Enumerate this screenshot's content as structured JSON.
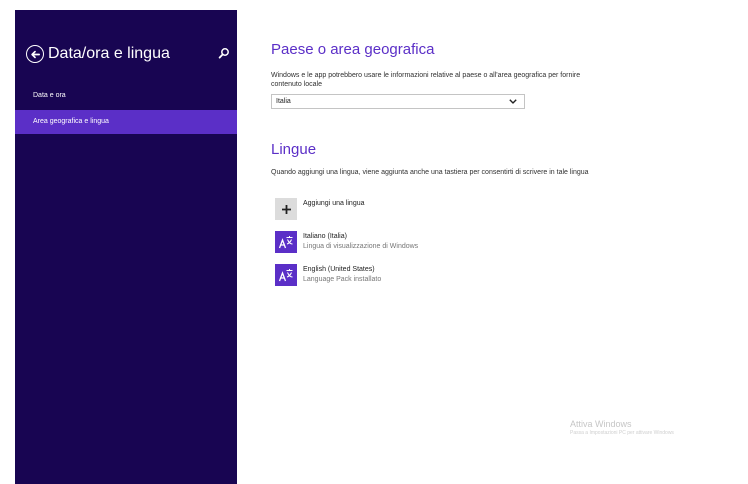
{
  "sidebar": {
    "title": "Data/ora e lingua",
    "icons": {
      "back": "back-arrow-circle-icon",
      "search": "search-icon"
    },
    "items": [
      {
        "label": "Data e ora",
        "selected": false
      },
      {
        "label": "Area geografica e lingua",
        "selected": true
      }
    ]
  },
  "main": {
    "region": {
      "title": "Paese o area geografica",
      "description": "Windows e le app potrebbero usare le informazioni relative al paese o all'area geografica per fornire contenuto locale",
      "selected_country": "Italia"
    },
    "languages": {
      "title": "Lingue",
      "description": "Quando aggiungi una lingua, viene aggiunta anche una tastiera per consentirti di scrivere in tale lingua",
      "add_label": "Aggiungi una lingua",
      "items": [
        {
          "name": "Italiano (Italia)",
          "status": "Lingua di visualizzazione di Windows"
        },
        {
          "name": "English (United States)",
          "status": "Language Pack installato"
        }
      ]
    }
  },
  "watermark": {
    "title": "Attiva Windows",
    "subtitle": "Passa a Impostazioni PC per attivare Windows"
  },
  "colors": {
    "sidebar_bg": "#180552",
    "accent": "#5b2fc7",
    "text": "#303030"
  }
}
